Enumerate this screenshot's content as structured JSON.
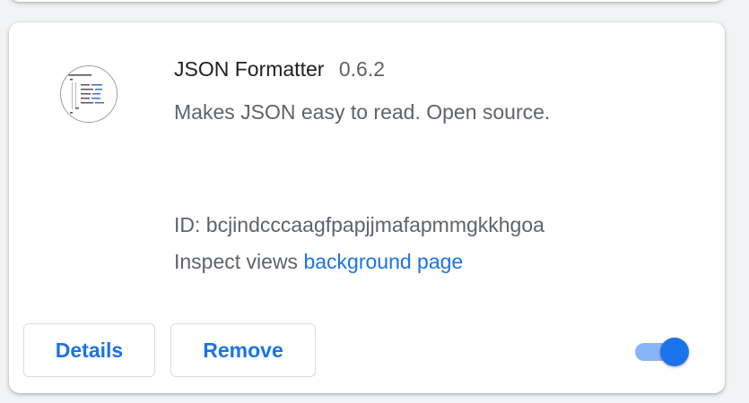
{
  "extension": {
    "name": "JSON Formatter",
    "version": "0.6.2",
    "description": "Makes JSON easy to read. Open source.",
    "id_label": "ID: bcjindcccaagfpapjjmafapmmgkkhgoa",
    "inspect_prefix": "Inspect views ",
    "inspect_link": "background page",
    "icon": "json-code-icon",
    "enabled": true
  },
  "buttons": {
    "details": "Details",
    "remove": "Remove"
  },
  "colors": {
    "accent": "#1a73e8",
    "toggle_track": "#8ab4f8",
    "card_background": "#ffffff",
    "page_background": "#f1f3f4"
  }
}
